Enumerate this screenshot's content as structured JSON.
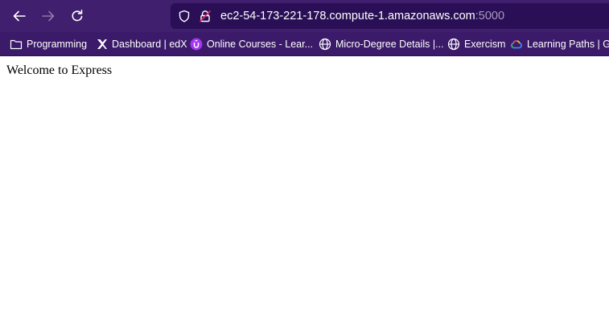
{
  "navbar": {
    "back_icon": "arrow-left-icon",
    "forward_icon": "arrow-right-icon",
    "reload_icon": "reload-icon",
    "url": {
      "host": "ec2-54-173-221-178.compute-1.amazonaws.com",
      "port": ":5000"
    },
    "shield_icon": "shield-icon",
    "lock_icon": "lock-icon"
  },
  "bookmarks": [
    {
      "label": "Programming",
      "icon": "folder-icon"
    },
    {
      "label": "Dashboard | edX",
      "icon": "edx-icon"
    },
    {
      "label": "Online Courses - Lear...",
      "icon": "udemy-icon"
    },
    {
      "label": "Micro-Degree Details |...",
      "icon": "globe-icon"
    },
    {
      "label": "Exercism",
      "icon": "globe-icon"
    },
    {
      "label": "Learning Paths | Go",
      "icon": "google-cloud-icon"
    }
  ],
  "page": {
    "text": "Welcome to Express"
  },
  "colors": {
    "navbar_bg": "#3f1f6e",
    "urlbar_bg": "#2a0f56",
    "bookmarks_bg": "#3a1a69",
    "udemy_accent": "#a435f0"
  }
}
